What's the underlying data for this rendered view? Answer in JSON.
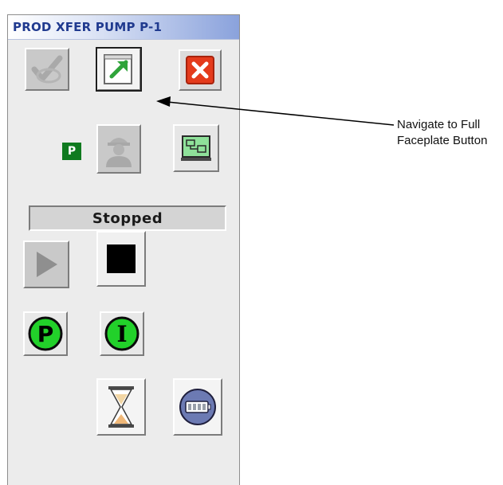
{
  "faceplate": {
    "title": "PROD XFER PUMP P-1",
    "mode_badge": "P",
    "status": "Stopped",
    "buttons": {
      "acknowledge": {
        "icon": "acknowledge-check-icon",
        "enabled": false
      },
      "navigate_full_faceplate": {
        "icon": "navigate-full-faceplate-icon",
        "enabled": true
      },
      "close": {
        "icon": "close-icon",
        "color": "#e43b1c"
      },
      "operator": {
        "icon": "operator-icon",
        "enabled": false
      },
      "detail_display": {
        "icon": "display-window-icon",
        "enabled": true
      },
      "start": {
        "icon": "start-triangle-icon",
        "enabled": false
      },
      "stop": {
        "icon": "stop-square-icon",
        "enabled": true
      },
      "program_mode": {
        "label": "P",
        "color": "#22d12a"
      },
      "interlock": {
        "label": "I",
        "color": "#22d12a"
      },
      "timer": {
        "icon": "hourglass-icon"
      },
      "maintenance": {
        "icon": "battery-gauge-icon",
        "color": "#6c7ab3"
      }
    }
  },
  "callout": {
    "line1": "Navigate to Full",
    "line2": "Faceplate Button"
  }
}
